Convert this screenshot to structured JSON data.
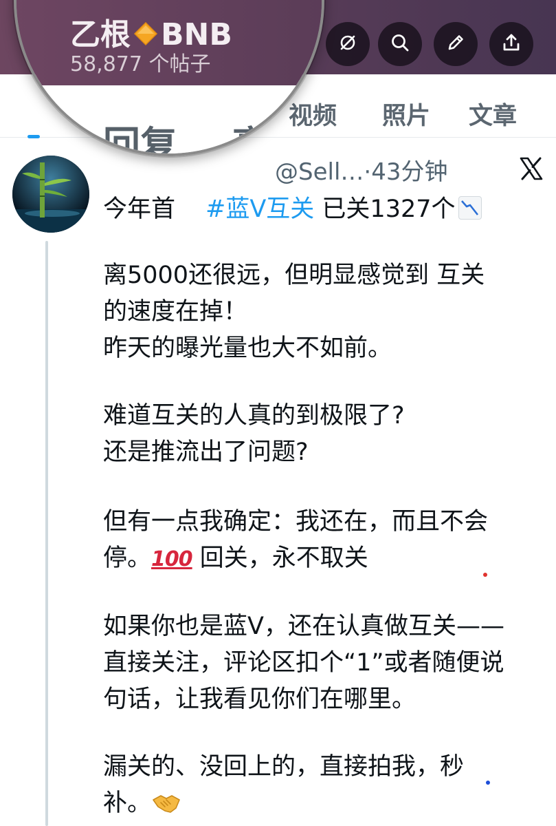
{
  "profile": {
    "name": "乙根",
    "name_suffix": "BNB",
    "post_count": "58,877 个帖子"
  },
  "header_icons": [
    "hide-icon",
    "search-icon",
    "edit-icon",
    "share-icon"
  ],
  "tabs": {
    "visible": [
      "视频",
      "照片",
      "文章"
    ],
    "magnified": [
      "回复",
      "亮点"
    ],
    "partial_glyph": "子"
  },
  "post": {
    "meta_fragment": "@Sell…·43分钟",
    "first_line_prefix": "今年首",
    "hashtag": "#蓝V互关",
    "first_line_suffix": " 已关1327个",
    "paragraph1": [
      "离5000还很远，但明显感觉到 互关",
      "的速度在掉！",
      "昨天的曝光量也大不如前。"
    ],
    "paragraph2": [
      "难道互关的人真的到极限了?",
      "还是推流出了问题?"
    ],
    "paragraph3_line1": "但有一点我确定：我还在，而且不会",
    "paragraph3_line2_a": "停。",
    "emoji_100": "100",
    "paragraph3_line2_b": " 回关，永不取关",
    "paragraph4": [
      "如果你也是蓝V，还在认真做互关——",
      "直接关注，评论区扣个“1”或者随便说",
      "句话，让我看见你们在哪里。"
    ],
    "paragraph5_line1": "漏关的、没回上的，直接拍我，秒",
    "paragraph5_line2": "补。"
  },
  "colors": {
    "header_bg": "#5b3d58",
    "link_blue": "#1d9bf0",
    "muted_text": "#536471"
  }
}
